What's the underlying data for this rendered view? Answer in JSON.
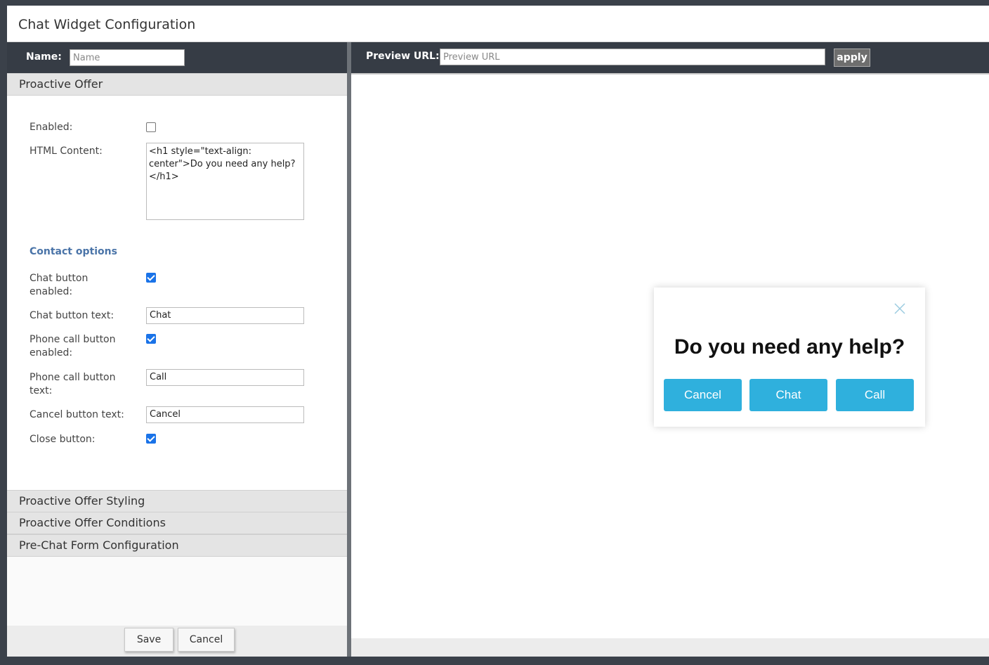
{
  "window": {
    "title": "Chat Widget Configuration"
  },
  "toolbar": {
    "name_label": "Name:",
    "name_placeholder": "Name",
    "preview_label": "Preview URL:",
    "preview_placeholder": "Preview URL",
    "apply_label": "apply"
  },
  "accordion": {
    "proactive_offer": "Proactive Offer",
    "styling": "Proactive Offer Styling",
    "conditions": "Proactive Offer Conditions",
    "prechat": "Pre-Chat Form Configuration"
  },
  "form": {
    "enabled_label": "Enabled:",
    "enabled_checked": false,
    "html_label": "HTML Content:",
    "html_value": "<h1 style=\"text-align: center\">Do you need any help?</h1>",
    "contact_options_title": "Contact options",
    "chat_enabled_label_1": "Chat button",
    "chat_enabled_label_2": "enabled:",
    "chat_enabled_checked": true,
    "chat_text_label": "Chat button text:",
    "chat_text_value": "Chat",
    "phone_enabled_label_1": "Phone call button",
    "phone_enabled_label_2": "enabled:",
    "phone_enabled_checked": true,
    "phone_text_label_1": "Phone call button",
    "phone_text_label_2": "text:",
    "phone_text_value": "Call",
    "cancel_text_label": "Cancel button text:",
    "cancel_text_value": "Cancel",
    "close_label": "Close button:",
    "close_checked": true
  },
  "footer": {
    "save_label": "Save",
    "cancel_label": "Cancel"
  },
  "preview": {
    "heading": "Do you need any help?",
    "cancel_label": "Cancel",
    "chat_label": "Chat",
    "call_label": "Call"
  },
  "colors": {
    "dark_chrome": "#363c45",
    "accent_button": "#2fb0dd",
    "section_title": "#4a74a8"
  },
  "icons": {
    "close": "close-x-icon"
  }
}
